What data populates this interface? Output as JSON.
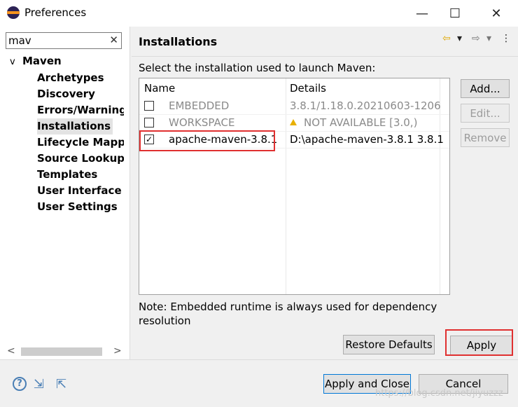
{
  "window": {
    "title": "Preferences",
    "minimize": "—",
    "maximize": "☐",
    "close": "✕"
  },
  "filter": {
    "value": "mav",
    "clear": "✕"
  },
  "tree": {
    "root": "Maven",
    "caret": "v",
    "items": [
      {
        "label": "Archetypes"
      },
      {
        "label": "Discovery"
      },
      {
        "label": "Errors/Warnings"
      },
      {
        "label": "Installations",
        "selected": true
      },
      {
        "label": "Lifecycle Mappings"
      },
      {
        "label": "Source Lookup"
      },
      {
        "label": "Templates"
      },
      {
        "label": "User Interface"
      },
      {
        "label": "User Settings"
      }
    ],
    "scroll_left": "<",
    "scroll_right": ">"
  },
  "page": {
    "title": "Installations",
    "nav_back": "⇦",
    "nav_back_menu": "▾",
    "nav_forward": "⇨",
    "nav_forward_menu": "▾",
    "menu": "⋮",
    "prompt": "Select the installation used to launch Maven:"
  },
  "table": {
    "headers": {
      "name": "Name",
      "details": "Details"
    },
    "rows": [
      {
        "name": "EMBEDDED",
        "details": "3.8.1/1.18.0.20210603-1206",
        "checked": false,
        "greyed": true
      },
      {
        "name": "WORKSPACE",
        "details": "NOT AVAILABLE [3.0,)",
        "checked": false,
        "greyed": true,
        "warning": true
      },
      {
        "name": "apache-maven-3.8.1",
        "details": "D:\\apache-maven-3.8.1 3.8.1",
        "checked": true,
        "greyed": false
      }
    ],
    "check_mark": "✓"
  },
  "side_buttons": {
    "add": "Add...",
    "edit": "Edit...",
    "remove": "Remove"
  },
  "note": "Note: Embedded runtime is always used for dependency resolution",
  "buttons": {
    "restore_defaults": "Restore Defaults",
    "apply": "Apply",
    "apply_and_close": "Apply and Close",
    "cancel": "Cancel"
  },
  "footer": {
    "help": "?",
    "import": "⇲",
    "export": "⇱"
  },
  "watermark": "https://blog.csdn.net/jiyuzzz",
  "colors": {
    "highlight": "#e03030",
    "icon_blue": "#4a7fb5",
    "warning": "#e8b000"
  }
}
